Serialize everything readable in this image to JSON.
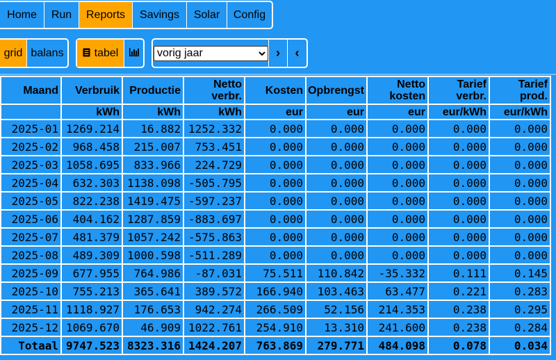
{
  "nav": {
    "items": [
      {
        "label": "Home"
      },
      {
        "label": "Run"
      },
      {
        "label": "Reports"
      },
      {
        "label": "Savings"
      },
      {
        "label": "Solar"
      },
      {
        "label": "Config"
      }
    ],
    "active": "Reports"
  },
  "view_toggle": {
    "grid": "grid",
    "balans": "balans"
  },
  "mode_toggle": {
    "tabel": "tabel",
    "tabel_icon": "document-icon",
    "chart_icon": "bar-chart-icon"
  },
  "period": {
    "selected": "vorig jaar",
    "next": "›",
    "prev": "‹"
  },
  "colors": {
    "background": "#2196f3",
    "accent": "#ffa500",
    "border": "#ffffff"
  },
  "table": {
    "headers": [
      "Maand",
      "Verbruik",
      "Productie",
      "Netto verbr.",
      "Kosten",
      "Opbrengst",
      "Netto kosten",
      "Tarief verbr.",
      "Tarief prod."
    ],
    "units": [
      "",
      "kWh",
      "kWh",
      "kWh",
      "eur",
      "eur",
      "eur",
      "eur/kWh",
      "eur/kWh"
    ],
    "rows": [
      [
        "2025-01",
        "1269.214",
        "16.882",
        "1252.332",
        "0.000",
        "0.000",
        "0.000",
        "0.000",
        "0.000"
      ],
      [
        "2025-02",
        "968.458",
        "215.007",
        "753.451",
        "0.000",
        "0.000",
        "0.000",
        "0.000",
        "0.000"
      ],
      [
        "2025-03",
        "1058.695",
        "833.966",
        "224.729",
        "0.000",
        "0.000",
        "0.000",
        "0.000",
        "0.000"
      ],
      [
        "2025-04",
        "632.303",
        "1138.098",
        "-505.795",
        "0.000",
        "0.000",
        "0.000",
        "0.000",
        "0.000"
      ],
      [
        "2025-05",
        "822.238",
        "1419.475",
        "-597.237",
        "0.000",
        "0.000",
        "0.000",
        "0.000",
        "0.000"
      ],
      [
        "2025-06",
        "404.162",
        "1287.859",
        "-883.697",
        "0.000",
        "0.000",
        "0.000",
        "0.000",
        "0.000"
      ],
      [
        "2025-07",
        "481.379",
        "1057.242",
        "-575.863",
        "0.000",
        "0.000",
        "0.000",
        "0.000",
        "0.000"
      ],
      [
        "2025-08",
        "489.309",
        "1000.598",
        "-511.289",
        "0.000",
        "0.000",
        "0.000",
        "0.000",
        "0.000"
      ],
      [
        "2025-09",
        "677.955",
        "764.986",
        "-87.031",
        "75.511",
        "110.842",
        "-35.332",
        "0.111",
        "0.145"
      ],
      [
        "2025-10",
        "755.213",
        "365.641",
        "389.572",
        "166.940",
        "103.463",
        "63.477",
        "0.221",
        "0.283"
      ],
      [
        "2025-11",
        "1118.927",
        "176.653",
        "942.274",
        "266.509",
        "52.156",
        "214.353",
        "0.238",
        "0.295"
      ],
      [
        "2025-12",
        "1069.670",
        "46.909",
        "1022.761",
        "254.910",
        "13.310",
        "241.600",
        "0.238",
        "0.284"
      ]
    ],
    "total": [
      "Totaal",
      "9747.523",
      "8323.316",
      "1424.207",
      "763.869",
      "279.771",
      "484.098",
      "0.078",
      "0.034"
    ]
  }
}
